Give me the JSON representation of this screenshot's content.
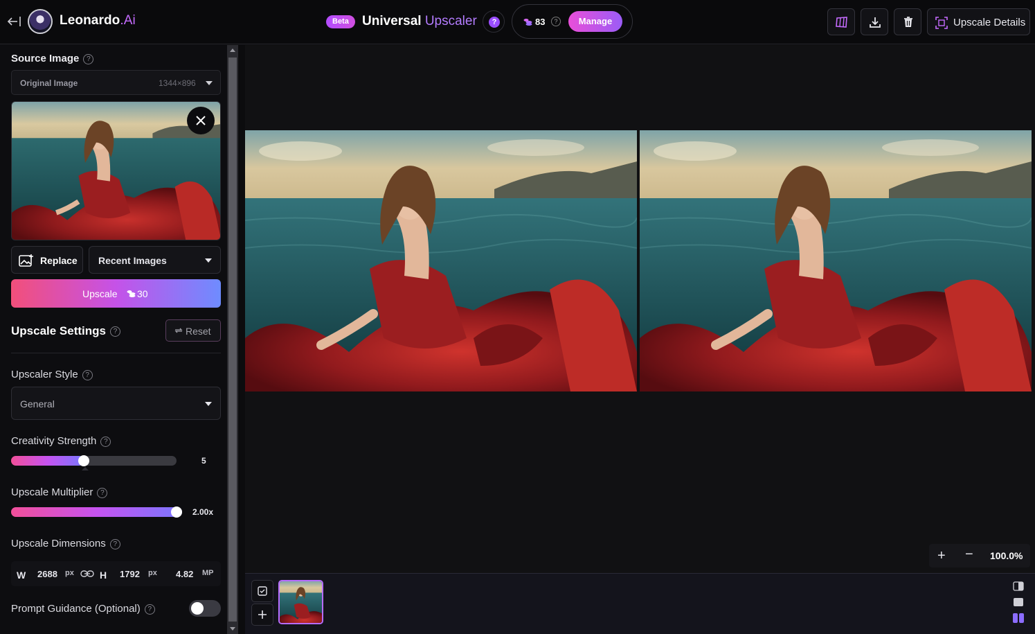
{
  "header": {
    "brand_name": "Leonardo",
    "brand_suffix": ".Ai",
    "beta_label": "Beta",
    "title_main": "Universal",
    "title_accent": "Upscaler",
    "help_label": "?",
    "credits": "83",
    "manage_label": "Manage",
    "details_label": "Upscale Details"
  },
  "sidebar": {
    "source_label": "Source Image",
    "source_select_value": "Original Image",
    "source_dimensions": "1344×896",
    "replace_label": "Replace",
    "recent_label": "Recent Images",
    "upscale_label": "Upscale",
    "upscale_cost": "30",
    "settings_title": "Upscale Settings",
    "reset_label": "Reset",
    "style_label": "Upscaler Style",
    "style_value": "General",
    "creativity_label": "Creativity Strength",
    "creativity_value": "5",
    "creativity_fraction": 0.44,
    "multiplier_label": "Upscale Multiplier",
    "multiplier_value": "2.00x",
    "multiplier_fraction": 1.0,
    "dimensions_label": "Upscale Dimensions",
    "width_label": "W",
    "width_value": "2688",
    "height_label": "H",
    "height_value": "1792",
    "unit": "px",
    "megapixels": "4.82",
    "mp_label": "MP",
    "prompt_label": "Prompt Guidance (Optional)"
  },
  "canvas": {
    "zoom_value": "100.0%"
  },
  "colors": {
    "accent": "#b47cff",
    "manage_gradient_start": "#e94fd9",
    "manage_gradient_end": "#9b5cf6"
  }
}
